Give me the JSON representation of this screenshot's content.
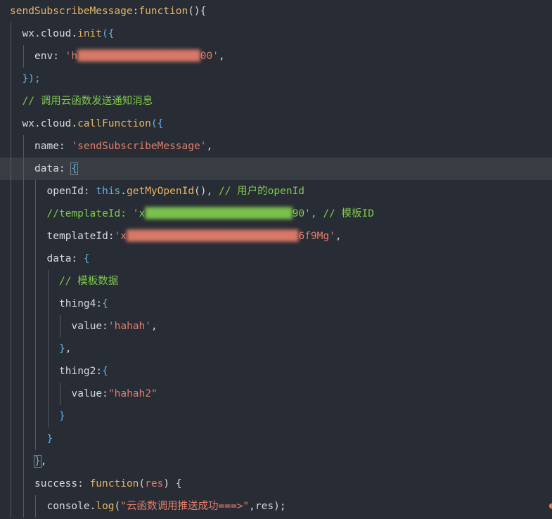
{
  "editor": {
    "colors": {
      "background": "#282c34",
      "active_line": "#383c43",
      "plain": "#d7dae0",
      "keyword": "#e5b567",
      "function": "#e5b567",
      "property": "#d7dae0",
      "string": "#e27d6a",
      "comment": "#7fca4e",
      "this_keyword": "#5fb3e8",
      "brace": "#5fb3e8",
      "paren": "#d7dae0"
    },
    "lines": [
      {
        "indent": 0,
        "tokens": [
          {
            "t": "sendSubscribeMessage",
            "c": "function"
          },
          {
            "t": ":",
            "c": "plain"
          },
          {
            "t": "function",
            "c": "keyword"
          },
          {
            "t": "(){",
            "c": "plain"
          }
        ]
      },
      {
        "indent": 1,
        "tokens": [
          {
            "t": "wx",
            "c": "plain"
          },
          {
            "t": ".",
            "c": "plain"
          },
          {
            "t": "cloud",
            "c": "plain"
          },
          {
            "t": ".",
            "c": "plain"
          },
          {
            "t": "init",
            "c": "function"
          },
          {
            "t": "({",
            "c": "brace"
          }
        ]
      },
      {
        "indent": 2,
        "tokens": [
          {
            "t": "env",
            "c": "property"
          },
          {
            "t": ": ",
            "c": "plain"
          },
          {
            "t": "'h",
            "c": "string"
          },
          {
            "t": "████████████████████",
            "c": "string",
            "masked": true
          },
          {
            "t": "00'",
            "c": "string"
          },
          {
            "t": ",",
            "c": "plain"
          }
        ]
      },
      {
        "indent": 1,
        "tokens": [
          {
            "t": "});",
            "c": "brace"
          }
        ]
      },
      {
        "indent": 1,
        "tokens": [
          {
            "t": "// 调用云函数发送通知消息",
            "c": "comment"
          }
        ]
      },
      {
        "indent": 1,
        "tokens": [
          {
            "t": "wx",
            "c": "plain"
          },
          {
            "t": ".",
            "c": "plain"
          },
          {
            "t": "cloud",
            "c": "plain"
          },
          {
            "t": ".",
            "c": "plain"
          },
          {
            "t": "callFunction",
            "c": "function"
          },
          {
            "t": "({",
            "c": "brace"
          }
        ]
      },
      {
        "indent": 2,
        "tokens": [
          {
            "t": "name",
            "c": "property"
          },
          {
            "t": ": ",
            "c": "plain"
          },
          {
            "t": "'sendSubscribeMessage'",
            "c": "string"
          },
          {
            "t": ",",
            "c": "plain"
          }
        ]
      },
      {
        "indent": 2,
        "active": true,
        "tokens": [
          {
            "t": "data",
            "c": "property"
          },
          {
            "t": ": ",
            "c": "plain"
          },
          {
            "t": "{",
            "c": "brace",
            "hl": true
          }
        ]
      },
      {
        "indent": 3,
        "tokens": [
          {
            "t": "openId",
            "c": "property"
          },
          {
            "t": ": ",
            "c": "plain"
          },
          {
            "t": "this",
            "c": "this_keyword"
          },
          {
            "t": ".",
            "c": "plain"
          },
          {
            "t": "getMyOpenId",
            "c": "function"
          },
          {
            "t": "(), ",
            "c": "plain"
          },
          {
            "t": "// 用户的openId",
            "c": "comment"
          }
        ]
      },
      {
        "indent": 3,
        "tokens": [
          {
            "t": "//templateId: 'x",
            "c": "comment"
          },
          {
            "t": "████████████████████████",
            "c": "comment",
            "masked": true
          },
          {
            "t": "90', // 模板ID",
            "c": "comment"
          }
        ]
      },
      {
        "indent": 3,
        "tokens": [
          {
            "t": "templateId",
            "c": "property"
          },
          {
            "t": ":",
            "c": "plain"
          },
          {
            "t": "'x",
            "c": "string"
          },
          {
            "t": "████████████████████████████",
            "c": "string",
            "masked": true
          },
          {
            "t": "6f9Mg'",
            "c": "string"
          },
          {
            "t": ",",
            "c": "plain"
          }
        ]
      },
      {
        "indent": 3,
        "tokens": [
          {
            "t": "data",
            "c": "property"
          },
          {
            "t": ": ",
            "c": "plain"
          },
          {
            "t": "{",
            "c": "brace"
          }
        ]
      },
      {
        "indent": 4,
        "tokens": [
          {
            "t": "// 模板数据",
            "c": "comment"
          }
        ]
      },
      {
        "indent": 4,
        "tokens": [
          {
            "t": "thing4",
            "c": "property"
          },
          {
            "t": ":",
            "c": "plain"
          },
          {
            "t": "{",
            "c": "brace"
          }
        ]
      },
      {
        "indent": 5,
        "tokens": [
          {
            "t": "value",
            "c": "property"
          },
          {
            "t": ":",
            "c": "plain"
          },
          {
            "t": "'hahah'",
            "c": "string"
          },
          {
            "t": ",",
            "c": "plain"
          }
        ]
      },
      {
        "indent": 4,
        "tokens": [
          {
            "t": "}",
            "c": "brace"
          },
          {
            "t": ",",
            "c": "plain"
          }
        ]
      },
      {
        "indent": 4,
        "tokens": [
          {
            "t": "thing2",
            "c": "property"
          },
          {
            "t": ":",
            "c": "plain"
          },
          {
            "t": "{",
            "c": "brace"
          }
        ]
      },
      {
        "indent": 5,
        "tokens": [
          {
            "t": "value",
            "c": "property"
          },
          {
            "t": ":",
            "c": "plain"
          },
          {
            "t": "\"hahah2\"",
            "c": "string"
          }
        ]
      },
      {
        "indent": 4,
        "tokens": [
          {
            "t": "}",
            "c": "brace"
          }
        ]
      },
      {
        "indent": 3,
        "tokens": [
          {
            "t": "}",
            "c": "brace"
          }
        ]
      },
      {
        "indent": 2,
        "tokens": [
          {
            "t": "}",
            "c": "brace",
            "hl": true
          },
          {
            "t": ",",
            "c": "plain"
          }
        ]
      },
      {
        "indent": 2,
        "tokens": [
          {
            "t": "success",
            "c": "property"
          },
          {
            "t": ": ",
            "c": "plain"
          },
          {
            "t": "function",
            "c": "keyword"
          },
          {
            "t": "(",
            "c": "plain"
          },
          {
            "t": "res",
            "c": "string"
          },
          {
            "t": ") ",
            "c": "plain"
          },
          {
            "t": "{",
            "c": "plain"
          }
        ]
      },
      {
        "indent": 3,
        "tokens": [
          {
            "t": "console",
            "c": "plain"
          },
          {
            "t": ".",
            "c": "plain"
          },
          {
            "t": "log",
            "c": "function"
          },
          {
            "t": "(",
            "c": "plain"
          },
          {
            "t": "\"云函数调用推送成功===>\"",
            "c": "string"
          },
          {
            "t": ",res);",
            "c": "plain"
          }
        ]
      }
    ]
  }
}
